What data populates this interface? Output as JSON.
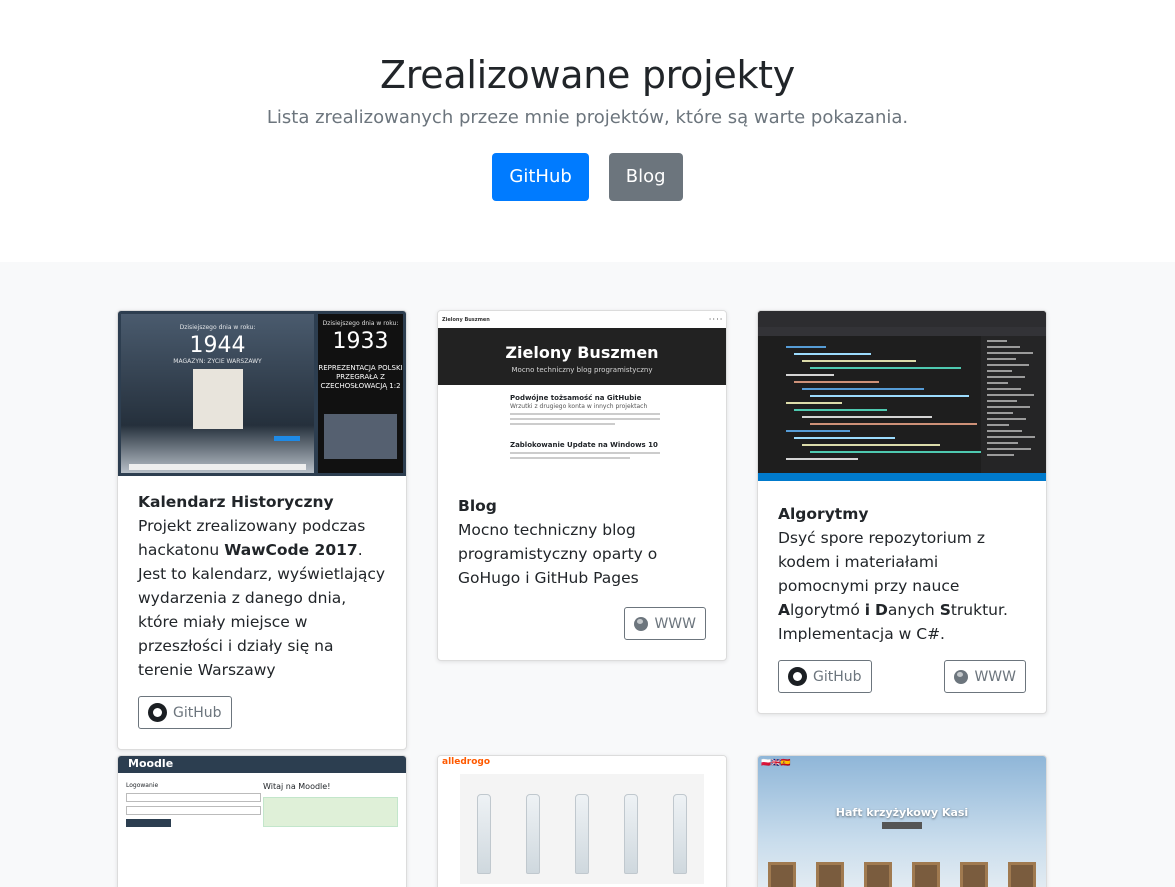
{
  "hero": {
    "title": "Zrealizowane projekty",
    "lead": "Lista zrealizowanych przeze mnie projektów, które są warte pokazania.",
    "github_label": "GitHub",
    "blog_label": "Blog"
  },
  "colors": {
    "primary": "#007bff",
    "secondary": "#6c757d",
    "album_bg": "#f8f9fa"
  },
  "cards": [
    {
      "title": "Kalendarz Historyczny",
      "text_a": "Projekt zrealizowany podczas hackatonu ",
      "text_bold": "WawCode 2017",
      "text_b": ". Jest to kalendarz, wyświetlający wydarzenia z danego dnia, które miały miejsce w przeszłości i działy się na terenie Warszawy",
      "github_label": "GitHub",
      "thumb": {
        "desk_caption": "Dzisiejszego dnia w roku:",
        "desk_year": "1944",
        "desk_headline": "MAGAZYN: ŻYCIE WARSZAWY",
        "phone_caption": "Dzisiejszego dnia w roku:",
        "phone_year": "1933",
        "phone_headline": "REPREZENTACJA POLSKI PRZEGRAŁA Z CZECHOSŁOWACJĄ 1:2"
      }
    },
    {
      "title": "Blog",
      "text": "Mocno techniczny blog programistyczny oparty o GoHugo i GitHub Pages",
      "www_label": "WWW",
      "thumb": {
        "nav_brand": "Zielony Buszmen",
        "header_title": "Zielony Buszmen",
        "header_sub": "Mocno techniczny blog programistyczny",
        "post1_title": "Podwójne tożsamość na GitHubie",
        "post1_sub": "Wrzutki z drugiego konta w innych projektach",
        "post2_title": "Zablokowanie Update na Windows 10"
      }
    },
    {
      "title": "Algorytmy",
      "text_parts": [
        {
          "t": "Dsyć spore repozytorium z kodem i materiałami pomocnymi przy nauce ",
          "b": false
        },
        {
          "t": "A",
          "b": true
        },
        {
          "t": "lgorytmó ",
          "b": false
        },
        {
          "t": "i",
          "b": true
        },
        {
          "t": " ",
          "b": false
        },
        {
          "t": "D",
          "b": true
        },
        {
          "t": "anych ",
          "b": false
        },
        {
          "t": "S",
          "b": true
        },
        {
          "t": "truktur. Implementacja w C#.",
          "b": false
        }
      ],
      "github_label": "GitHub",
      "www_label": "WWW"
    },
    {
      "thumb": {
        "brand": "Moodle",
        "login_title": "Logowanie",
        "welcome": "Witaj na Moodle!"
      }
    },
    {
      "thumb": {
        "brand": "alledrogo"
      }
    },
    {
      "thumb": {
        "title": "Haft krzyżykowy Kasi"
      }
    }
  ]
}
